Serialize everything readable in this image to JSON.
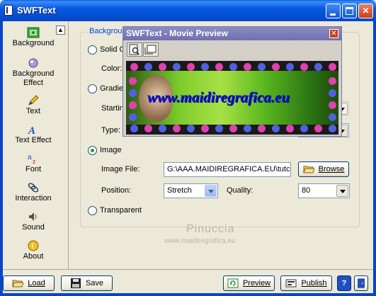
{
  "window": {
    "title": "SWFText"
  },
  "sidebar": {
    "items": [
      {
        "label": "Background",
        "icon": "background-icon"
      },
      {
        "label": "Background Effect",
        "icon": "background-effect-icon"
      },
      {
        "label": "Text",
        "icon": "text-pencil-icon"
      },
      {
        "label": "Text Effect",
        "icon": "text-effect-icon"
      },
      {
        "label": "Font",
        "icon": "font-icon"
      },
      {
        "label": "Interaction",
        "icon": "interaction-icon"
      },
      {
        "label": "Sound",
        "icon": "sound-icon"
      },
      {
        "label": "About",
        "icon": "about-icon"
      }
    ]
  },
  "background_panel": {
    "legend": "Backgroun",
    "solid_label": "Solid C",
    "color_label": "Color:",
    "gradient_label": "Gradie",
    "starting_label": "Startin",
    "type_label": "Type:",
    "image_label": "Image",
    "image_file_label": "Image File:",
    "image_file_value": "G:\\AAA.MAIDIREGRAFICA.EU\\tutc",
    "browse_label": "Browse",
    "position_label": "Position:",
    "position_value": "Stretch",
    "quality_label": "Quality:",
    "quality_value": "80",
    "transparent_label": "Transparent",
    "selected": "image"
  },
  "watermark": {
    "line1": "Pinuccia",
    "line2": "www.maidiregrafica.eu"
  },
  "preview": {
    "title": "SWFText - Movie Preview",
    "banner_text": "www.maidiregrafica.eu"
  },
  "toolbar": {
    "load_label": "Load",
    "save_label": "Save",
    "preview_label": "Preview",
    "publish_label": "Publish"
  },
  "colors": {
    "accent": "#0a5fe8",
    "frame": "#0646c9",
    "groupbox_legend": "#0046d5",
    "banner_text": "#1010d0"
  }
}
